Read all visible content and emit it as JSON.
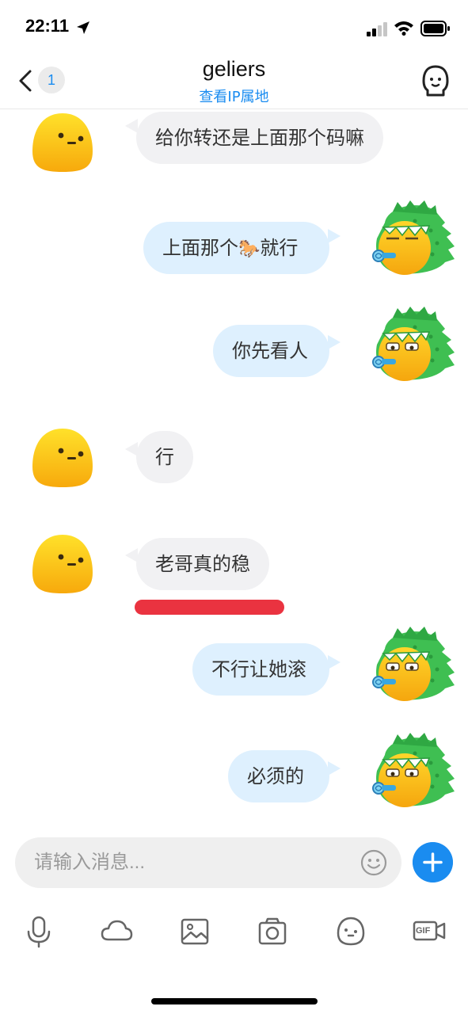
{
  "status_bar": {
    "time": "22:11"
  },
  "header": {
    "back_count": "1",
    "title": "geliers",
    "ip_link": "查看IP属地"
  },
  "messages": [
    {
      "direction": "incoming",
      "text": "给你转还是上面那个码嘛"
    },
    {
      "direction": "outgoing",
      "text_before": "上面那个",
      "emoji": "🐎",
      "text_after": "就行"
    },
    {
      "direction": "outgoing",
      "text": "你先看人"
    },
    {
      "direction": "incoming",
      "text": "行"
    },
    {
      "direction": "incoming",
      "text": "老哥真的稳"
    },
    {
      "direction": "outgoing",
      "text": "不行让她滚"
    },
    {
      "direction": "outgoing",
      "text": "必须的"
    }
  ],
  "input": {
    "placeholder": "请输入消息..."
  },
  "toolbar": {
    "gif_label": "GIF"
  },
  "colors": {
    "accent": "#1a8cf0",
    "incoming_bubble": "#f1f1f3",
    "outgoing_bubble": "#def0fe",
    "annotation": "#ea3340"
  }
}
